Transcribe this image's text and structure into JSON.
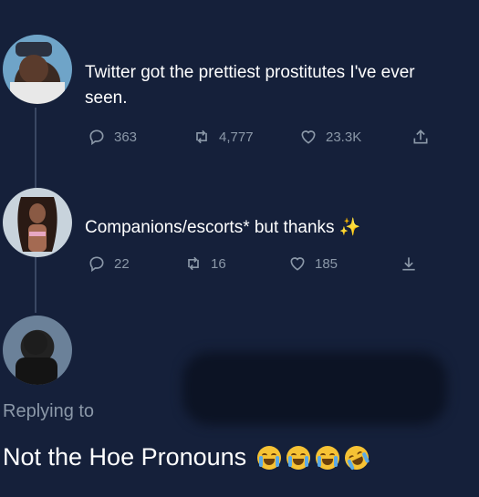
{
  "tweets": [
    {
      "text": "Twitter got the prettiest prostitutes I've ever seen.",
      "replies": "363",
      "retweets": "4,777",
      "likes": "23.3K"
    },
    {
      "text": "Companions/escorts* but thanks ✨",
      "replies": "22",
      "retweets": "16",
      "likes": "185"
    }
  ],
  "reply": {
    "replying_to": "Replying to",
    "text": "Not the Hoe Pronouns"
  },
  "icons": [
    "reply-icon",
    "retweet-icon",
    "like-icon",
    "share-icon",
    "sparkles-icon",
    "crying-laughing-emoji",
    "rofl-emoji"
  ]
}
